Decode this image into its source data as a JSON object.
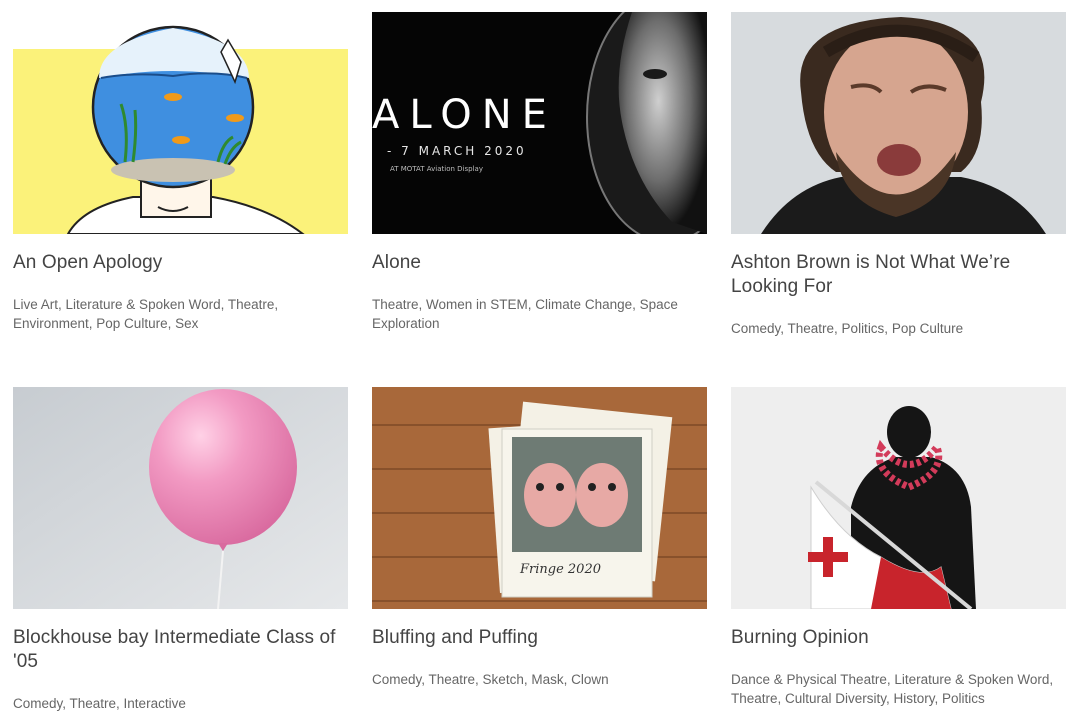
{
  "cards": [
    {
      "title": "An Open Apology",
      "tags": "Live Art, Literature & Spoken Word, Theatre, Environment, Pop Culture, Sex"
    },
    {
      "title": "Alone",
      "tags": "Theatre, Women in STEM, Climate Change, Space Exploration",
      "poster": {
        "word": "ALONE",
        "date": "- 7 MARCH 2020",
        "venue": "AT MOTAT Aviation Display"
      }
    },
    {
      "title": "Ashton Brown is Not What We’re Looking For",
      "tags": "Comedy, Theatre, Politics, Pop Culture"
    },
    {
      "title": "Blockhouse bay Intermediate Class of '05",
      "tags": "Comedy, Theatre, Interactive"
    },
    {
      "title": "Bluffing and Puffing",
      "tags": "Comedy, Theatre, Sketch, Mask, Clown",
      "poster": {
        "caption": "Fringe 2020"
      }
    },
    {
      "title": "Burning Opinion",
      "tags": "Dance & Physical Theatre, Literature & Spoken Word, Theatre, Cultural Diversity, History, Politics"
    }
  ],
  "colors": {
    "title": "#444444",
    "tags": "#666666",
    "yellow": "#fbf27a",
    "balloon": "#f29ac3"
  }
}
